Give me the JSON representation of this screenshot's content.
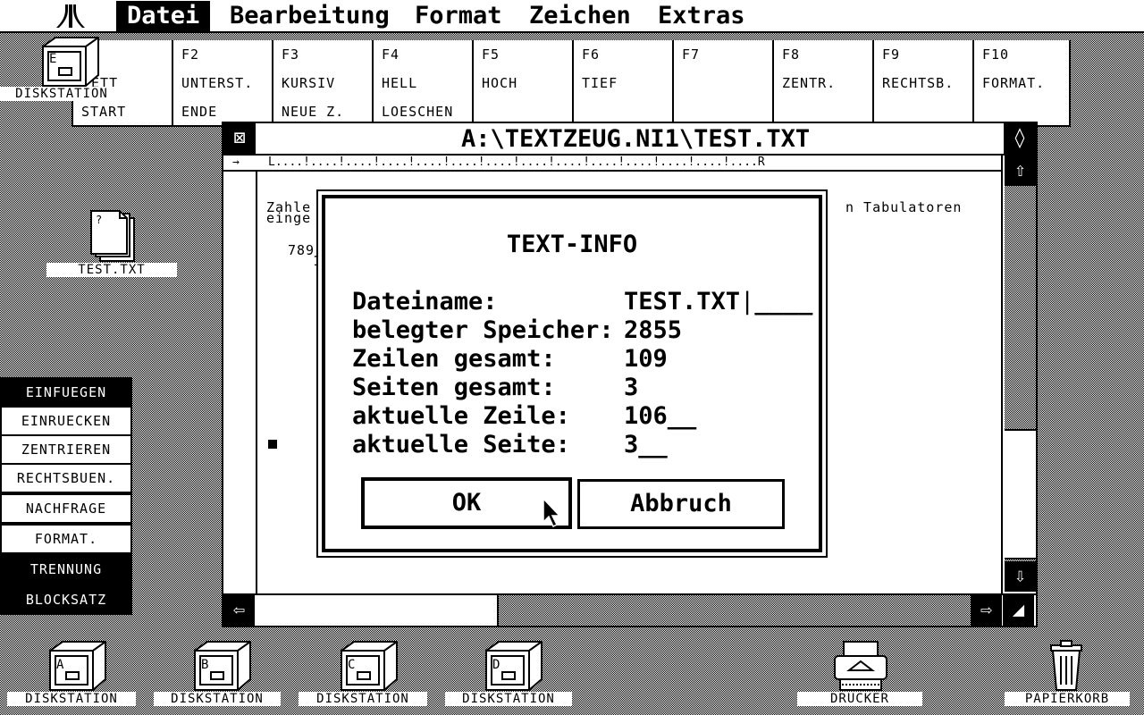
{
  "menubar": {
    "items": [
      {
        "label": "Datei",
        "active": true
      },
      {
        "label": "Bearbeitung"
      },
      {
        "label": "Format"
      },
      {
        "label": "Zeichen"
      },
      {
        "label": "Extras"
      }
    ]
  },
  "fkeys": [
    {
      "key": "",
      "label": "FETT",
      "label2": "START"
    },
    {
      "key": "F2",
      "label": "UNTERST.",
      "label2": "ENDE"
    },
    {
      "key": "F3",
      "label": "KURSIV",
      "label2": "NEUE Z."
    },
    {
      "key": "F4",
      "label": "HELL",
      "label2": "LOESCHEN"
    },
    {
      "key": "F5",
      "label": "HOCH",
      "label2": ""
    },
    {
      "key": "F6",
      "label": "TIEF",
      "label2": ""
    },
    {
      "key": "F7",
      "label": "",
      "label2": ""
    },
    {
      "key": "F8",
      "label": "ZENTR.",
      "label2": ""
    },
    {
      "key": "F9",
      "label": "RECHTSB.",
      "label2": ""
    },
    {
      "key": "F10",
      "label": "FORMAT.",
      "label2": ""
    }
  ],
  "desktop": {
    "top_drive": {
      "letter": "E",
      "label": "DISKSTATION"
    },
    "file_icon": {
      "label": "TEST.TXT"
    },
    "drives": [
      {
        "letter": "A",
        "label": "DISKSTATION"
      },
      {
        "letter": "B",
        "label": "DISKSTATION"
      },
      {
        "letter": "C",
        "label": "DISKSTATION"
      },
      {
        "letter": "D",
        "label": "DISKSTATION"
      }
    ],
    "printer": {
      "label": "DRUCKER"
    },
    "trash": {
      "label": "PAPIERKORB"
    }
  },
  "side_panel": [
    {
      "label": "EINFUEGEN",
      "inverted": true
    },
    {
      "label": "EINRUECKEN",
      "inverted": false
    },
    {
      "label": "ZENTRIEREN",
      "inverted": false
    },
    {
      "label": "RECHTSBUEN.",
      "inverted": false
    },
    {
      "label": "NACHFRAGE",
      "inverted": false
    },
    {
      "label": "FORMAT.",
      "inverted": false
    },
    {
      "label": "TRENNUNG",
      "inverted": true
    },
    {
      "label": "BLOCKSATZ",
      "inverted": true
    }
  ],
  "window": {
    "title": "A:\\TEXTZEUG.NI1\\TEST.TXT",
    "ruler": "L....!....!....!....!....!....!....!....!....!....!....!....!....!....R",
    "doc_line1": "Zahle",
    "doc_line2": "einge",
    "doc_line1_end": "n Tabulatoren",
    "doc_num": "789",
    "doc_num2": "1"
  },
  "dialog": {
    "title": "TEXT-INFO",
    "rows": [
      {
        "label": "Dateiname:",
        "value": "TEST.TXT"
      },
      {
        "label": "belegter Speicher:",
        "value": "2855"
      },
      {
        "label": "Zeilen gesamt:",
        "value": "109"
      },
      {
        "label": "Seiten gesamt:",
        "value": "3"
      },
      {
        "label": "aktuelle Zeile:",
        "value": "106"
      },
      {
        "label": "aktuelle Seite:",
        "value": "3"
      }
    ],
    "ok_label": "OK",
    "cancel_label": "Abbruch"
  },
  "colors": {
    "foreground": "#000000",
    "background": "#ffffff"
  }
}
